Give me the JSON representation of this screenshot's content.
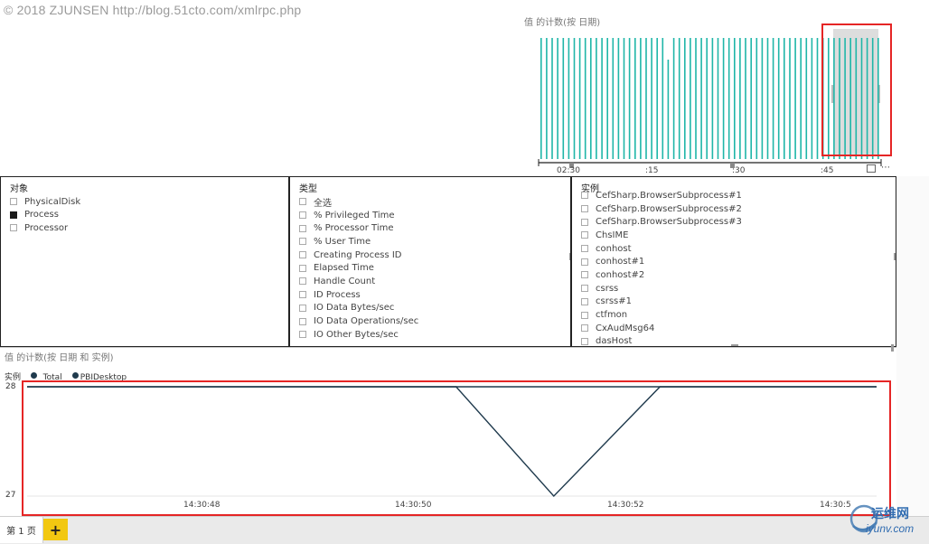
{
  "watermark": "© 2018 ZJUNSEN http://blog.51cto.com/xmlrpc.php",
  "top_chart": {
    "title": "值 的计数(按 日期)",
    "ticks": [
      "02:30",
      ":15",
      ":30",
      ":45"
    ]
  },
  "slicer_object": {
    "title": "对象",
    "items": [
      {
        "label": "PhysicalDisk",
        "checked": false
      },
      {
        "label": "Process",
        "checked": true
      },
      {
        "label": "Processor",
        "checked": false
      }
    ]
  },
  "slicer_type": {
    "title": "类型",
    "items": [
      {
        "label": "全选"
      },
      {
        "label": "% Privileged Time"
      },
      {
        "label": "% Processor Time"
      },
      {
        "label": "% User Time"
      },
      {
        "label": "Creating Process ID"
      },
      {
        "label": "Elapsed Time"
      },
      {
        "label": "Handle Count"
      },
      {
        "label": "ID Process"
      },
      {
        "label": "IO Data Bytes/sec"
      },
      {
        "label": "IO Data Operations/sec"
      },
      {
        "label": "IO Other Bytes/sec"
      }
    ]
  },
  "slicer_instance": {
    "title": "实例",
    "items": [
      {
        "label": "CefSharp.BrowserSubprocess#1"
      },
      {
        "label": "CefSharp.BrowserSubprocess#2"
      },
      {
        "label": "CefSharp.BrowserSubprocess#3"
      },
      {
        "label": "ChsIME"
      },
      {
        "label": "conhost"
      },
      {
        "label": "conhost#1"
      },
      {
        "label": "conhost#2"
      },
      {
        "label": "csrss"
      },
      {
        "label": "csrss#1"
      },
      {
        "label": "ctfmon"
      },
      {
        "label": "CxAudMsg64"
      },
      {
        "label": "dasHost"
      }
    ]
  },
  "line_chart": {
    "title": "值 的计数(按 日期 和 实例)",
    "legend_title": "实例",
    "legend_items": [
      "_Total",
      "PBIDesktop"
    ],
    "y_top": "28",
    "y_bottom": "27",
    "x_ticks": [
      "14:30:48",
      "14:30:50",
      "14:30:52",
      "14:30:5"
    ]
  },
  "chart_data": {
    "type": "line",
    "title": "值 的计数(按 日期 和 实例)",
    "xlabel": "",
    "ylabel": "",
    "ylim": [
      27,
      28
    ],
    "x": [
      0,
      0.505,
      0.62,
      0.745,
      1
    ],
    "series": [
      {
        "name": "_Total",
        "values": [
          28,
          28,
          28,
          28,
          28
        ]
      },
      {
        "name": "PBIDesktop",
        "values": [
          28,
          28,
          27,
          28,
          28
        ]
      }
    ]
  },
  "tabs": {
    "page1": "第 1 页",
    "add": "+"
  },
  "brand": {
    "name": "运维网",
    "site": "iyunv.com"
  },
  "colors": {
    "bars": "#1fb6a8",
    "highlight": "#e52525",
    "line": "#1f3a4d"
  }
}
